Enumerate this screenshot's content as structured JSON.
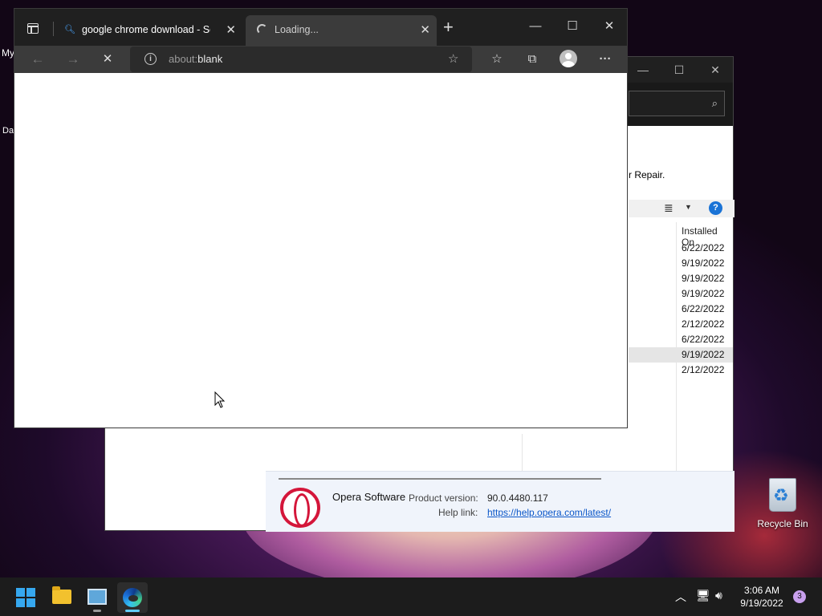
{
  "desktop": {
    "partial_label_top": "My",
    "partial_label_mid": "Da",
    "recycle_bin_label": "Recycle Bin"
  },
  "browser": {
    "tabs": [
      {
        "title": "google chrome download - Search",
        "state": "idle"
      },
      {
        "title": "Loading...",
        "state": "loading"
      }
    ],
    "new_tab_glyph": "+",
    "window_controls": {
      "minimize": "—",
      "maximize": "☐",
      "close": "✕"
    },
    "nav": {
      "back": "←",
      "forward": "→",
      "stop": "✕"
    },
    "address": {
      "prefix": "about:",
      "value": "blank"
    },
    "tool_glyphs": {
      "favorites": "☆",
      "collections": "⧉",
      "more": "···"
    }
  },
  "programs_window": {
    "repair_text": "r Repair.",
    "column_header": "Installed On",
    "installed_dates": [
      "6/22/2022",
      "9/19/2022",
      "9/19/2022",
      "9/19/2022",
      "6/22/2022",
      "2/12/2022",
      "6/22/2022",
      "9/19/2022",
      "2/12/2022"
    ],
    "selected_row_index": 7,
    "details": {
      "publisher": "Opera Software",
      "version_label": "Product version:",
      "version_value": "90.0.4480.117",
      "help_label": "Help link:",
      "help_value": "https://help.opera.com/latest/"
    }
  },
  "taskbar": {
    "clock_time": "3:06 AM",
    "clock_date": "9/19/2022",
    "notification_count": "3"
  },
  "colors": {
    "accent": "#60cdff",
    "opera_red": "#d4163a",
    "link_blue": "#0b57c9"
  }
}
